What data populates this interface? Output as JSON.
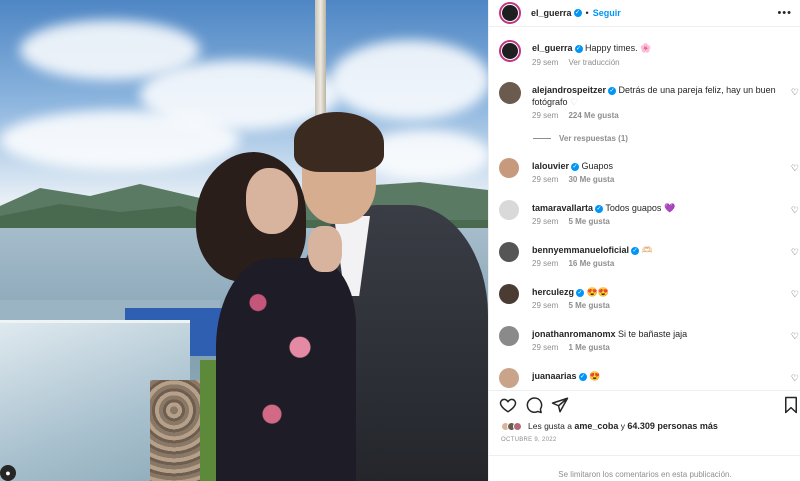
{
  "post": {
    "author": "el_guerra",
    "follow_label": "Seguir",
    "separator": "•"
  },
  "caption": {
    "author": "el_guerra",
    "text": "Happy times.",
    "emoji": "🌸",
    "age": "29 sem",
    "translate_label": "Ver traducción"
  },
  "comments": [
    {
      "user": "alejandrospeitzer",
      "text": "Detrás de una pareja feliz, hay un buen fotógrafo",
      "age": "29 sem",
      "likes": "224 Me gusta",
      "replies": "Ver respuestas (1)"
    },
    {
      "user": "lalouvier",
      "text": "Guapos",
      "age": "29 sem",
      "likes": "30 Me gusta"
    },
    {
      "user": "tamaravallarta",
      "text": "Todos guapos",
      "emoji": "💜",
      "age": "29 sem",
      "likes": "5 Me gusta"
    },
    {
      "user": "bennyemmanueloficial",
      "text": "🫶🏻",
      "age": "29 sem",
      "likes": "16 Me gusta"
    },
    {
      "user": "herculezg",
      "text": "😍😍",
      "age": "29 sem",
      "likes": "5 Me gusta"
    },
    {
      "user": "jonathanromanomx",
      "text": "Si te bañaste jaja",
      "age": "29 sem",
      "likes": "1 Me gusta"
    },
    {
      "user": "juanaarias",
      "text": "😍",
      "age": "",
      "likes": ""
    }
  ],
  "likes_line": {
    "prefix": "Les gusta a",
    "user": "ame_coba",
    "middle": "y",
    "count": "64.309 personas más"
  },
  "date": "OCTUBRE 9, 2022",
  "footer": "Se limitaron los comentarios en esta publicación.",
  "icons": {
    "heart": "heart-icon",
    "comment": "comment-icon",
    "share": "share-icon",
    "save": "bookmark-icon",
    "more": "more-icon"
  },
  "colors": {
    "accent": "#0095f6",
    "ring": "#c13584",
    "muted": "#8e8e8e"
  }
}
